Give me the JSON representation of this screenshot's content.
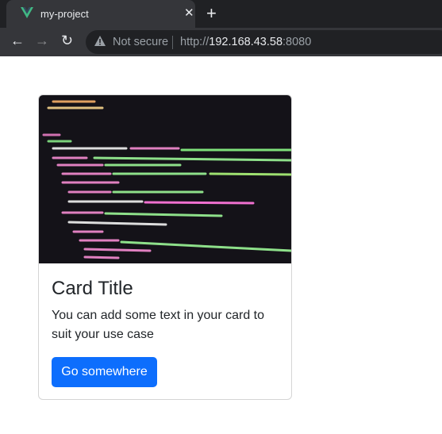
{
  "browser": {
    "tab_title": "my-project",
    "tab_icon": "vue-logo",
    "security": "Not secure",
    "url_scheme": "http://",
    "url_host": "192.168.43.58",
    "url_port": ":8080"
  },
  "card": {
    "image": "code-editor-photo",
    "title": "Card Title",
    "text": "You can add some text in your card to suit your use case",
    "button": "Go somewhere",
    "button_color": "#0d6efd"
  }
}
